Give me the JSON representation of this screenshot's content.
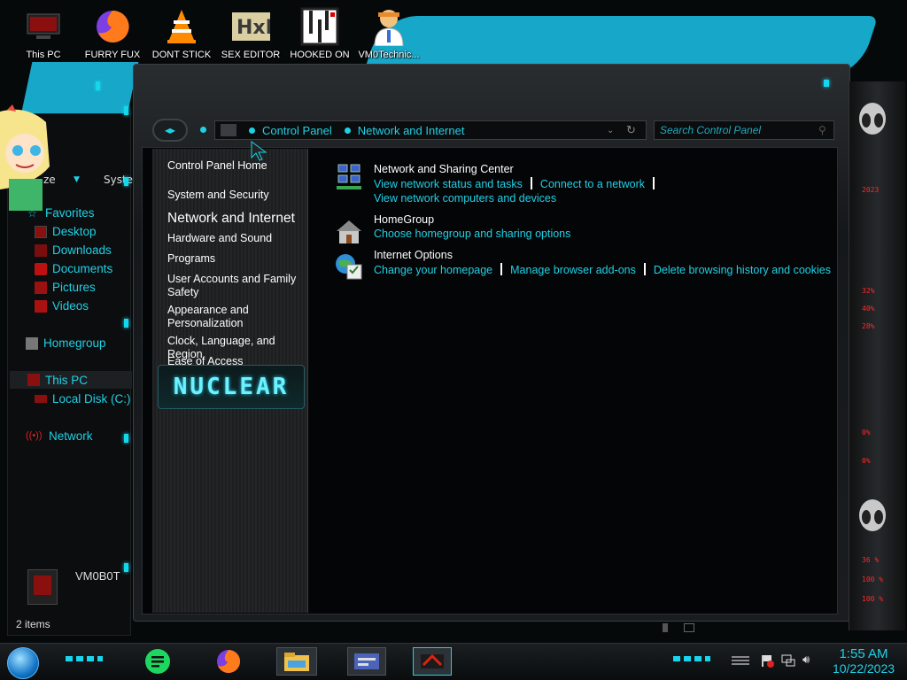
{
  "desktop": {
    "icons": [
      {
        "label": "This PC",
        "icon": "computer-icon"
      },
      {
        "label": "FURRY FUX",
        "icon": "firefox-icon"
      },
      {
        "label": "DONT STICK",
        "icon": "vlc-icon"
      },
      {
        "label": "SEX EDITOR",
        "icon": "hex-editor-icon"
      },
      {
        "label": "HOOKED ON",
        "icon": "maze-icon"
      },
      {
        "label": "VM0Technic...",
        "icon": "doctor-avatar-icon"
      }
    ]
  },
  "background_window": {
    "toolbar": {
      "organize": "ze",
      "system": "Syste"
    },
    "nav": [
      {
        "label": "Favorites",
        "icon": "star-icon"
      },
      {
        "label": "Desktop",
        "icon": "desktop-icon"
      },
      {
        "label": "Downloads",
        "icon": "downloads-icon"
      },
      {
        "label": "Documents",
        "icon": "documents-icon"
      },
      {
        "label": "Pictures",
        "icon": "pictures-icon"
      },
      {
        "label": "Videos",
        "icon": "videos-icon"
      },
      {
        "label": "Homegroup",
        "icon": "homegroup-icon"
      },
      {
        "label": "This PC",
        "icon": "computer-icon"
      },
      {
        "label": "Local Disk (C:)",
        "icon": "disk-icon"
      },
      {
        "label": "Network",
        "icon": "network-icon"
      }
    ],
    "details_name": "VM0B0T",
    "status": "2 items"
  },
  "control_panel": {
    "breadcrumb": [
      "Control Panel",
      "Network and Internet"
    ],
    "search_placeholder": "Search Control Panel",
    "left_pane": {
      "home": "Control Panel Home",
      "items": [
        "System and Security",
        "Network and Internet",
        "Hardware and Sound",
        "Programs",
        "User Accounts and Family Safety",
        "Appearance and Personalization",
        "Clock, Language, and Region",
        "Ease of Access"
      ],
      "current": "Network and Internet",
      "logo_text": "NUCLEAR"
    },
    "categories": [
      {
        "title": "Network and Sharing Center",
        "icon": "network-sharing-icon",
        "links": [
          "View network status and tasks",
          "Connect to a network",
          "View network computers and devices"
        ]
      },
      {
        "title": "HomeGroup",
        "icon": "homegroup-house-icon",
        "links": [
          "Choose homegroup and sharing options"
        ]
      },
      {
        "title": "Internet Options",
        "icon": "internet-options-icon",
        "links": [
          "Change your homepage",
          "Manage browser add-ons",
          "Delete browsing history and cookies"
        ]
      }
    ]
  },
  "gadget": {
    "values": [
      "2023",
      "32%",
      "40%",
      "28%",
      "0%",
      "0%",
      "36 %",
      "100 %",
      "100 %"
    ]
  },
  "taskbar": {
    "apps": [
      "spotify-like-icon",
      "firefox-icon",
      "file-explorer-icon",
      "control-panel-icon",
      "alienware-icon"
    ],
    "clock": {
      "time": "1:55 AM",
      "date": "10/22/2023"
    },
    "tray": [
      "action-center-flag-icon",
      "network-tray-icon",
      "volume-icon"
    ]
  },
  "colors": {
    "accent": "#1fd1e6",
    "link": "#1fd1e6",
    "gadget_text": "#ff2a2a"
  }
}
